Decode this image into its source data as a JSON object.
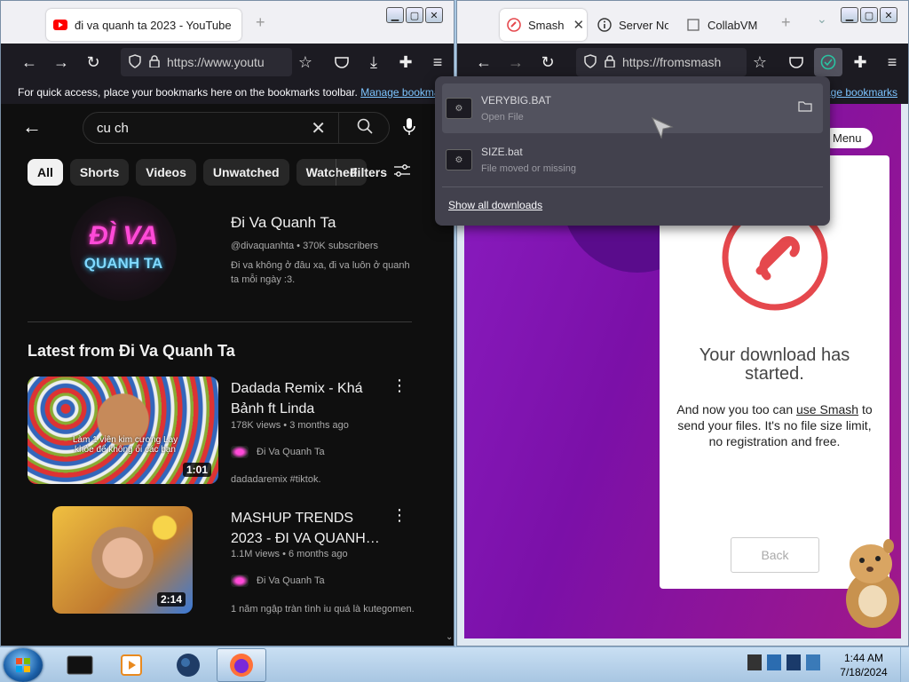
{
  "left_window": {
    "tab_title": "đi va quanh ta 2023 - YouTube",
    "url": "https://www.youtu",
    "bookmarks_msg": "For quick access, place your bookmarks here on the bookmarks toolbar.",
    "bookmarks_link": "Manage bookmar",
    "search_text": "cu ch",
    "chips": [
      "All",
      "Shorts",
      "Videos",
      "Unwatched",
      "Watched"
    ],
    "filters_label": "Filters",
    "channel": {
      "name": "Đi Va Quanh Ta",
      "handle": "@divaquanhta • 370K subscribers",
      "desc": "Đi va không ở đâu xa, đi va luôn ở quanh ta mỗi ngày :3.",
      "avatar_line1": "ĐÌ VA",
      "avatar_line2": "QUANH TA"
    },
    "section_title": "Latest from Đi Va Quanh Ta",
    "videos": [
      {
        "title": "Dadada Remix - Khá Bảnh ft Linda",
        "meta": "178K views • 3 months ago",
        "channel": "Đi Va Quanh Ta",
        "desc": "dadadaremix #tiktok.",
        "duration": "1:01",
        "thumb_caption": "Làm 1 viên kim cương Lay khỏe để không ổi các bạn"
      },
      {
        "title": "MASHUP TRENDS 2023 - ĐI VA QUANH…",
        "meta": "1.1M views • 6 months ago",
        "channel": "Đi Va Quanh Ta",
        "desc": "1 năm ngập tràn tình iu quá là kutegomen.",
        "duration": "2:14"
      }
    ]
  },
  "right_window": {
    "tabs": [
      {
        "title": "Smash"
      },
      {
        "title": "Server Not"
      },
      {
        "title": "CollabVM"
      }
    ],
    "url": "https://fromsmash",
    "bookmarks_link": "age bookmarks",
    "menu_label": "Menu",
    "card": {
      "heading": "Your download has started.",
      "body_pre": "And now you too can ",
      "body_link": "use Smash",
      "body_post": " to send your files. It's no file size limit, no registration and free.",
      "back_label": "Back"
    }
  },
  "downloads": {
    "items": [
      {
        "name": "VERYBIG.BAT",
        "status": "Open File"
      },
      {
        "name": "SIZE.bat",
        "status": "File moved or missing"
      }
    ],
    "show_all": "Show all downloads"
  },
  "taskbar": {
    "time": "1:44 AM",
    "date": "7/18/2024"
  },
  "colors": {
    "youtube_bg": "#0f0f0f",
    "smash_purple": "#8a1cc0",
    "smash_red": "#e5484d",
    "firefox_toolbar": "#1c1b22"
  }
}
